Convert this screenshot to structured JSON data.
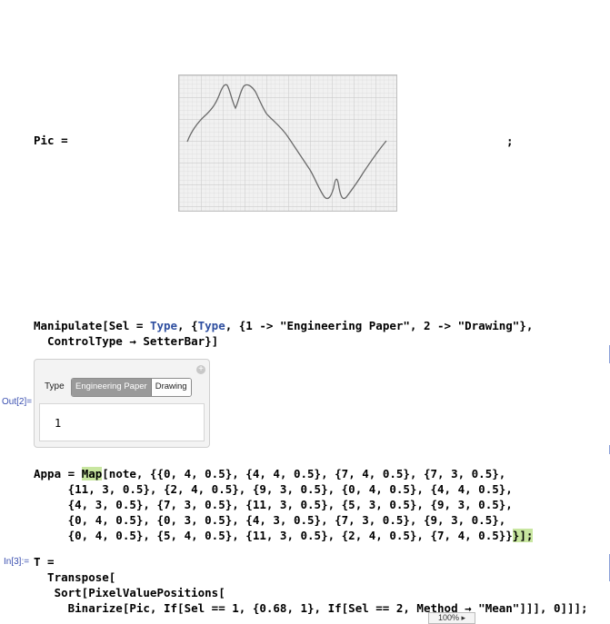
{
  "pic_cell": {
    "lhs": "Pic =",
    "suffix": ";"
  },
  "manipulate": {
    "line1_a": "Manipulate[Sel = ",
    "line1_type1": "Type",
    "line1_b": ", {",
    "line1_type2": "Type",
    "line1_c": ", {1 -> \"Engineering Paper\", 2 -> \"Drawing\"},",
    "line2": "  ControlType → SetterBar}]"
  },
  "output_label": "Out[2]=",
  "panel": {
    "type_label": "Type",
    "options": [
      "Engineering Paper",
      "Drawing"
    ],
    "selected_index": 0,
    "value": "1",
    "plus_icon": "+"
  },
  "appa": {
    "a1": "Appa = ",
    "a2": "Map",
    "a3": "[note, {{0, 4, 0.5}, {4, 4, 0.5}, {7, 4, 0.5}, {7, 3, 0.5},",
    "lines": [
      "     {11, 3, 0.5}, {2, 4, 0.5}, {9, 3, 0.5}, {0, 4, 0.5}, {4, 4, 0.5},",
      "     {4, 3, 0.5}, {7, 3, 0.5}, {11, 3, 0.5}, {5, 3, 0.5}, {9, 3, 0.5},",
      "     {0, 4, 0.5}, {0, 3, 0.5}, {4, 3, 0.5}, {7, 3, 0.5}, {9, 3, 0.5},"
    ],
    "last_a": "     {0, 4, 0.5}, {5, 4, 0.5}, {11, 3, 0.5}, {2, 4, 0.5}, {7, 4, 0.5}}",
    "last_b": "}];"
  },
  "input_label": "In[3]:=",
  "tcell": {
    "lines": [
      "T =",
      "  Transpose[",
      "   Sort[PixelValuePositions[",
      "     Binarize[Pic, If[Sel == 1, {0.68, 1}, If[Sel == 2, Method → \"Mean\"]]], 0]]];"
    ]
  },
  "status_bar": {
    "zoom": "100%",
    "zoom_icon": "▸"
  }
}
